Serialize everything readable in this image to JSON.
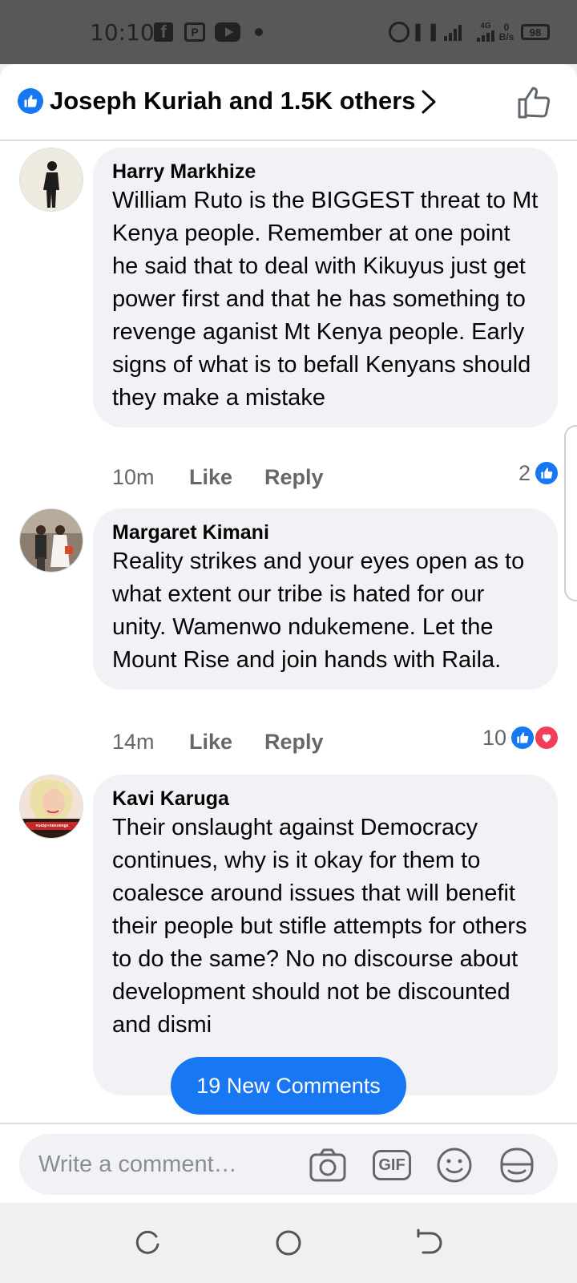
{
  "status_bar": {
    "time": "10:10",
    "signal_type": "4G",
    "data_rate_value": "0",
    "data_rate_unit": "B/s",
    "battery": "98"
  },
  "header": {
    "title": "Joseph Kuriah and 1.5K others"
  },
  "comments": [
    {
      "author": "Harry Markhize",
      "text": "William Ruto is the BIGGEST threat to Mt Kenya people. Remember at one point he said that to deal with Kikuyus just get power first and that he has something to revenge aganist Mt Kenya people. Early signs of what is to befall Kenyans should they make a mistake",
      "time": "10m",
      "like_label": "Like",
      "reply_label": "Reply",
      "reactions": "2"
    },
    {
      "author": "Margaret Kimani",
      "text": "Reality strikes and your eyes open as to what extent our tribe is hated for our unity. Wamenwo ndukemene. Let the Mount Rise and join hands with Raila.",
      "time": "14m",
      "like_label": "Like",
      "reply_label": "Reply",
      "reactions": "10"
    },
    {
      "author": "Kavi Karuga",
      "text": "Their onslaught against Democracy continues, why is it okay for them to coalesce around issues that will benefit their people but stifle attempts for others to do the same? No no discourse about development should not be discounted and dismi",
      "avatar_caption": "#StopTheKillings"
    }
  ],
  "new_comments_label": "19 New Comments",
  "composer": {
    "placeholder": "Write a comment…",
    "gif_label": "GIF"
  },
  "colors": {
    "accent": "#1877f2",
    "love": "#f33e58",
    "bubble": "#f0f2f5"
  },
  "icons": [
    "like-badge-icon",
    "chevron-right-icon",
    "thumbs-up-icon",
    "camera-icon",
    "gif-icon",
    "emoji-icon",
    "sticker-icon",
    "recent-apps-icon",
    "home-icon",
    "back-icon"
  ]
}
